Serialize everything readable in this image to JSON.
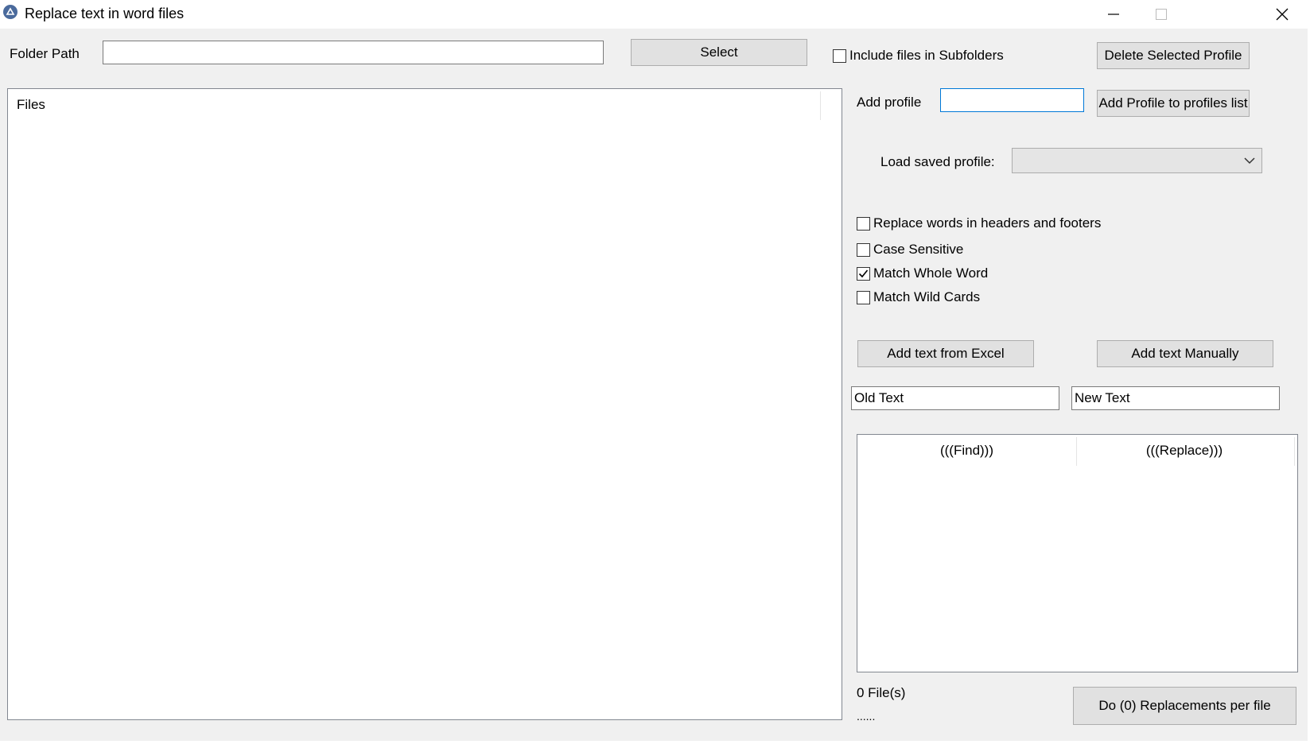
{
  "window": {
    "title": "Replace text in word files",
    "icons": {
      "app": "app-icon",
      "minimize": "minimize-icon",
      "maximize": "maximize-icon",
      "close": "close-icon"
    }
  },
  "folder": {
    "label": "Folder Path",
    "value": "",
    "select_label": "Select",
    "include_subfolders_label": "Include files in Subfolders",
    "include_subfolders_checked": false
  },
  "profiles": {
    "delete_label": "Delete Selected Profile",
    "add_label": "Add profile",
    "add_value": "",
    "add_to_list_label": "Add Profile to profiles list",
    "load_label": "Load saved profile:",
    "load_selected": ""
  },
  "files_list": {
    "header": "Files"
  },
  "options": [
    {
      "label": "Replace words in headers and footers",
      "checked": false
    },
    {
      "label": "Case Sensitive",
      "checked": false
    },
    {
      "label": "Match Whole Word",
      "checked": true
    },
    {
      "label": "Match Wild Cards",
      "checked": false
    }
  ],
  "text_actions": {
    "from_excel_label": "Add text from Excel",
    "manually_label": "Add text Manually",
    "old_text_value": "Old Text",
    "new_text_value": "New Text"
  },
  "replacements_table": {
    "columns": [
      "(((Find)))",
      "(((Replace)))"
    ],
    "rows": []
  },
  "status": {
    "file_count": "0 File(s)",
    "progress_text": "......",
    "run_label": "Do (0) Replacements per file"
  },
  "colors": {
    "window_bg": "#f0f0f0",
    "button_bg": "#e1e1e1",
    "focus_border": "#0078d7",
    "app_icon": "#4a6a9c"
  }
}
